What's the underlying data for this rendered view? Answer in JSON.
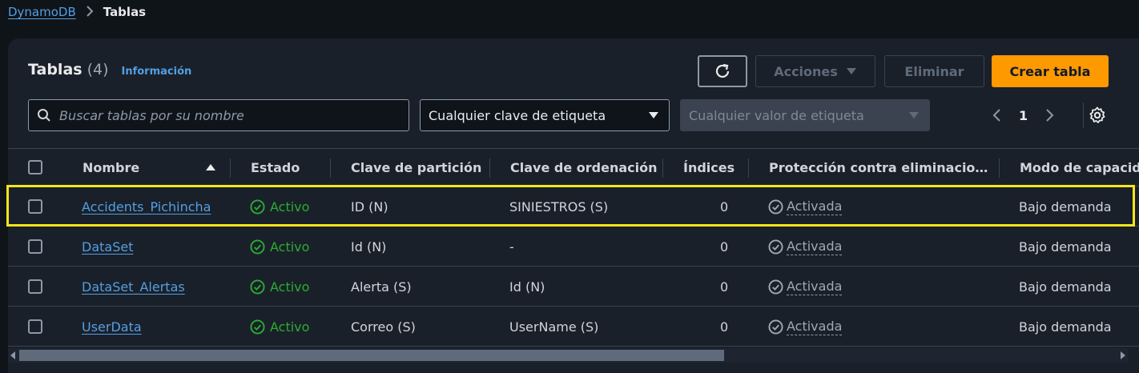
{
  "breadcrumb": {
    "parent": "DynamoDB",
    "current": "Tablas"
  },
  "header": {
    "title": "Tablas",
    "count": "(4)",
    "info_link": "Información"
  },
  "toolbar": {
    "refresh_icon": "refresh-icon",
    "actions_label": "Acciones",
    "delete_label": "Eliminar",
    "create_label": "Crear tabla"
  },
  "filters": {
    "search_placeholder": "Buscar tablas por su nombre",
    "tag_key_value": "Cualquier clave de etiqueta",
    "tag_value_placeholder": "Cualquier valor de etiqueta"
  },
  "pagination": {
    "current_page": "1"
  },
  "table": {
    "columns": [
      "Nombre",
      "Estado",
      "Clave de partición",
      "Clave de ordenación",
      "Índices",
      "Protección contra eliminacio…",
      "Modo de capacid"
    ],
    "rows": [
      {
        "name": "Accidents_Pichincha",
        "status": "Activo",
        "partition_key": "ID (N)",
        "sort_key": "SINIESTROS (S)",
        "indexes": "0",
        "protection": "Activada",
        "capacity": "Bajo demanda"
      },
      {
        "name": "DataSet",
        "status": "Activo",
        "partition_key": "Id (N)",
        "sort_key": "-",
        "indexes": "0",
        "protection": "Activada",
        "capacity": "Bajo demanda"
      },
      {
        "name": "DataSet_Alertas",
        "status": "Activo",
        "partition_key": "Alerta (S)",
        "sort_key": "Id (N)",
        "indexes": "0",
        "protection": "Activada",
        "capacity": "Bajo demanda"
      },
      {
        "name": "UserData",
        "status": "Activo",
        "partition_key": "Correo (S)",
        "sort_key": "UserName (S)",
        "indexes": "0",
        "protection": "Activada",
        "capacity": "Bajo demanda"
      }
    ]
  },
  "colors": {
    "accent_orange": "#ff9900",
    "link_blue": "#539fe5",
    "status_green": "#29ad32",
    "highlight_yellow": "#f7e51a"
  }
}
